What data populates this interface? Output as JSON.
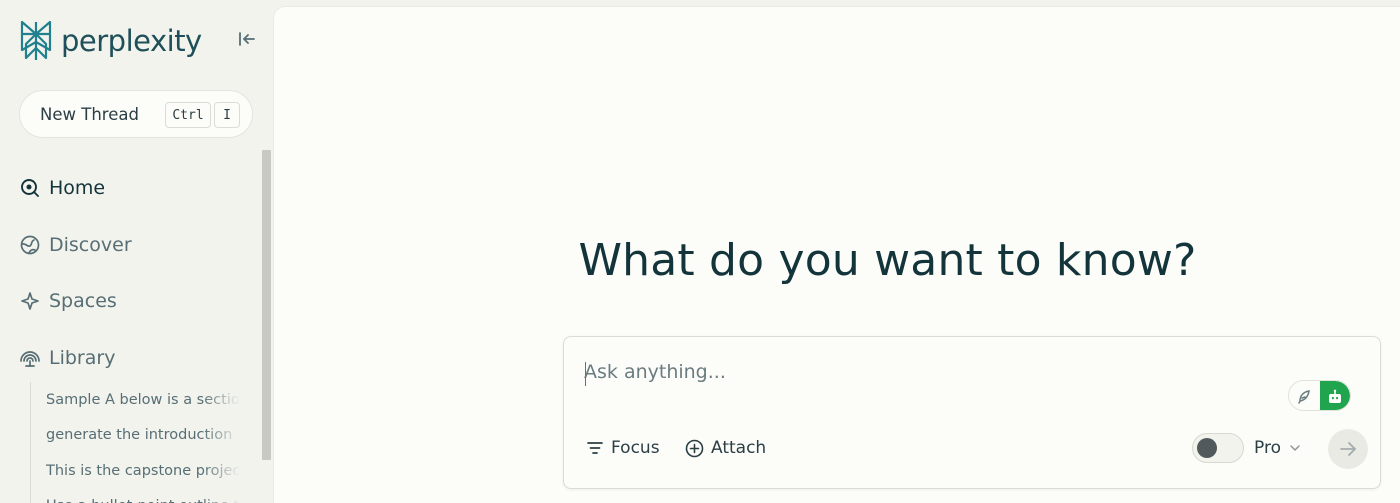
{
  "brand": {
    "name": "perplexity",
    "color": "#1f4f59"
  },
  "sidebar": {
    "new_thread": {
      "label": "New Thread",
      "shortcut": [
        "Ctrl",
        "I"
      ]
    },
    "nav": [
      {
        "label": "Home",
        "icon": "home-search-icon",
        "active": true
      },
      {
        "label": "Discover",
        "icon": "globe-icon",
        "active": false
      },
      {
        "label": "Spaces",
        "icon": "sparkle-icon",
        "active": false
      },
      {
        "label": "Library",
        "icon": "library-icon",
        "active": false
      }
    ],
    "library_items": [
      "Sample A below is a section",
      "generate the introduction",
      "This is the capstone project",
      "Use a bullet-point outline to"
    ]
  },
  "main": {
    "headline": "What do you want to know?",
    "ask": {
      "placeholder": "Ask anything..."
    },
    "focus_label": "Focus",
    "attach_label": "Attach",
    "model_label": "Pro",
    "accent_color": "#20a44e"
  }
}
